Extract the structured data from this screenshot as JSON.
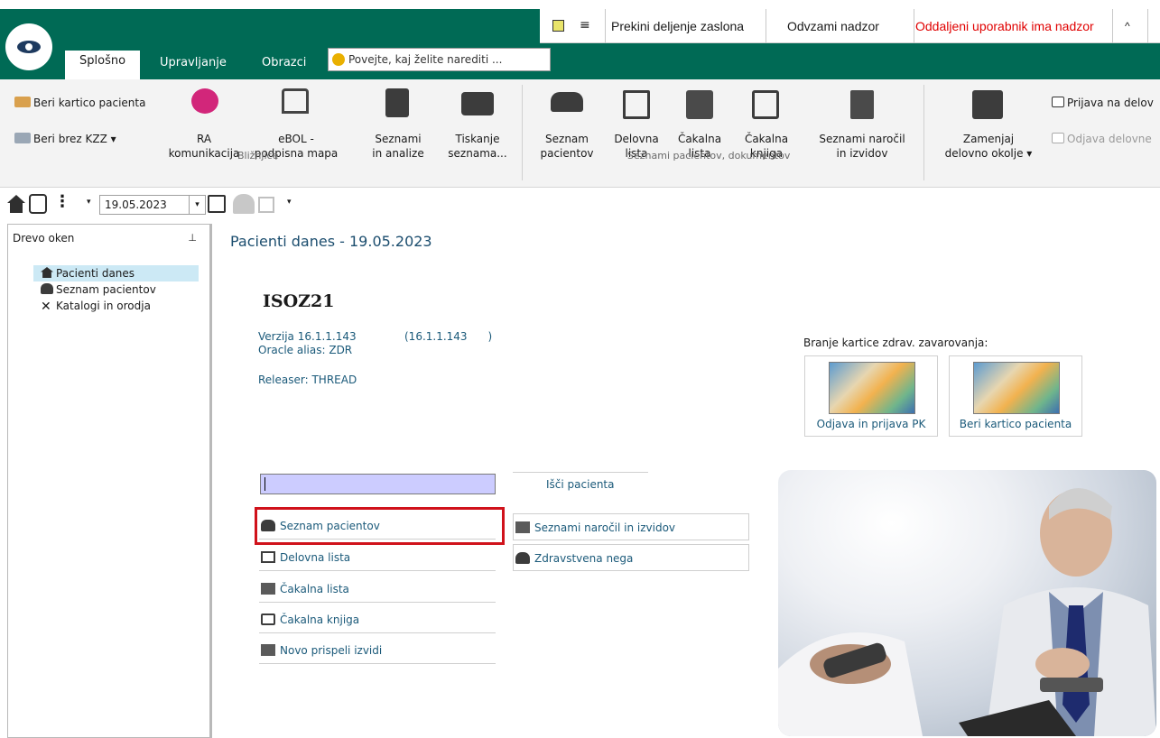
{
  "share_bar": {
    "stop_sharing": "Prekini deljenje zaslona",
    "revoke_control": "Odvzami nadzor",
    "remote_status": "Oddaljeni uporabnik ima nadzor",
    "remote_status_color": "#e00000"
  },
  "tabs": [
    "Splošno",
    "Upravljanje",
    "Obrazci"
  ],
  "tell_me": "Povejte, kaj želite narediti ...",
  "ribbon": {
    "read_card": "Beri kartico pacienta",
    "read_without": "Beri brez KZZ",
    "ra_1": "RA",
    "ra_2": "komunikacija",
    "ebol_1": "eBOL -",
    "ebol_2": "podpisna mapa",
    "lists_1": "Seznami",
    "lists_2": "in analize",
    "print_1": "Tiskanje",
    "print_2": "seznama...",
    "group1": "Bližnjice",
    "patients_1": "Seznam",
    "patients_2": "pacientov",
    "work_1": "Delovna",
    "work_2": "lista",
    "wait_1": "Čakalna",
    "wait_2": "lista",
    "waitbook_1": "Čakalna",
    "waitbook_2": "knjiga",
    "orders_1": "Seznami naročil",
    "orders_2": "in izvidov",
    "group2": "Seznami pacientov, dokumentov",
    "switch_1": "Zamenjaj",
    "switch_2": "delovno okolje",
    "login": "Prijava na delov",
    "logout": "Odjava delovne"
  },
  "date": "19.05.2023",
  "sidebar": {
    "header": "Drevo oken",
    "items": [
      "Pacienti danes",
      "Seznam pacientov",
      "Katalogi in orodja"
    ]
  },
  "main": {
    "title": "Pacienti danes - 19.05.2023",
    "app_name": "ISOZ21",
    "version": "Verzija 16.1.1.143",
    "version_paren": "(16.1.1.143      )",
    "oracle": "Oracle alias: ZDR",
    "releaser": "Releaser: THREAD",
    "card_label": "Branje kartice zdrav. zavarovanja:",
    "card1": "Odjava in prijava PK",
    "card2": "Beri kartico pacienta",
    "search_btn": "Išči pacienta",
    "links_left": [
      "Seznam pacientov",
      "Delovna lista",
      "Čakalna lista",
      "Čakalna knjiga",
      "Novo prispeli izvidi"
    ],
    "links_right": [
      "Seznami naročil in izvidov",
      "Zdravstvena nega"
    ]
  }
}
